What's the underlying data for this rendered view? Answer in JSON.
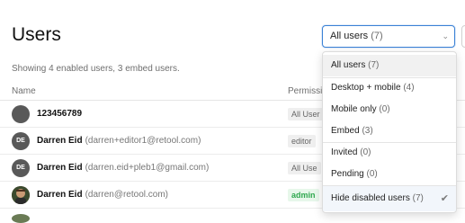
{
  "page": {
    "title": "Users"
  },
  "filter": {
    "label": "All users",
    "count": "(7)",
    "chevron": "chevron-down-icon"
  },
  "summary": "Showing 4 enabled users, 3 embed users.",
  "table": {
    "columns": {
      "name": "Name",
      "permissions": "Permissi"
    },
    "rows": [
      {
        "avatar_initials": "",
        "name": "123456789",
        "email": "",
        "permission": "All User"
      },
      {
        "avatar_initials": "DE",
        "name": "Darren Eid",
        "email": "(darren+editor1@retool.com)",
        "permission": "editor"
      },
      {
        "avatar_initials": "DE",
        "name": "Darren Eid",
        "email": "(darren.eid+pleb1@gmail.com)",
        "permission": "All Use"
      },
      {
        "avatar_initials": "",
        "name": "Darren Eid",
        "email": "(darren@retool.com)",
        "permission": "admin"
      }
    ]
  },
  "menu": {
    "items": [
      {
        "label": "All users",
        "count": "(7)"
      },
      {
        "label": "Desktop + mobile",
        "count": "(4)"
      },
      {
        "label": "Mobile only",
        "count": "(0)"
      },
      {
        "label": "Embed",
        "count": "(3)"
      },
      {
        "label": "Invited",
        "count": "(0)"
      },
      {
        "label": "Pending",
        "count": "(0)"
      },
      {
        "label": "Hide disabled users",
        "count": "(7)",
        "checked": true
      }
    ]
  },
  "colors": {
    "accent": "#3b82d6",
    "admin": "#2fa84f"
  }
}
